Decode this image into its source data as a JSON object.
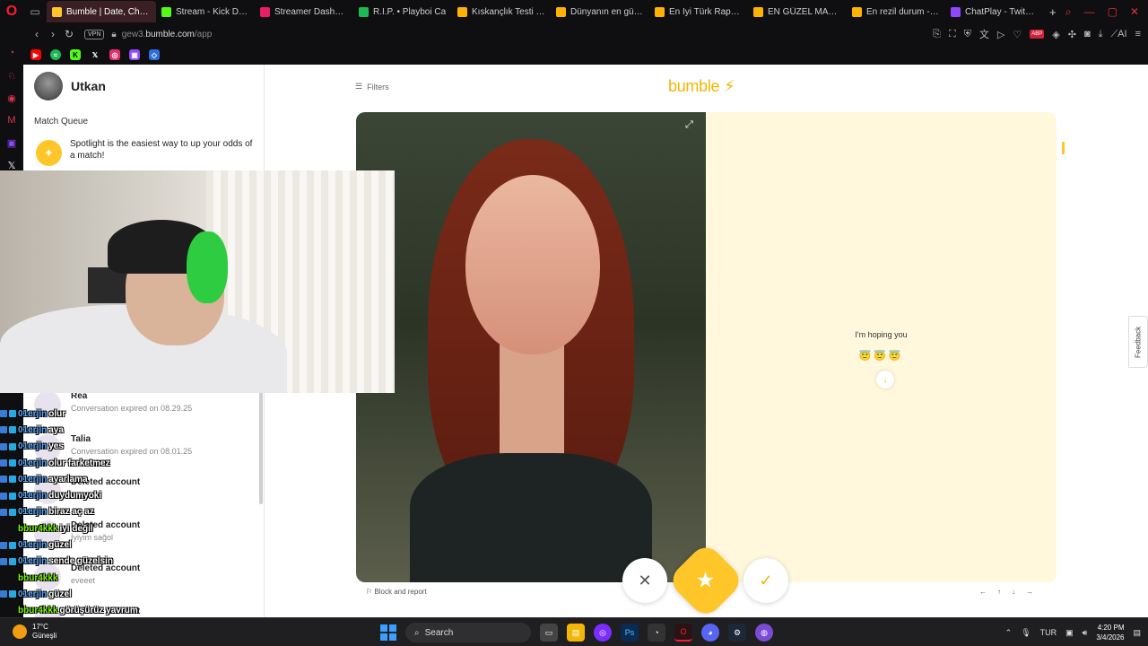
{
  "browser": {
    "tabs": [
      {
        "label": "Bumble | Date, Chat, Meet",
        "color": "#ffc629",
        "active": true
      },
      {
        "label": "Stream - Kick Dashb",
        "color": "#53fc18"
      },
      {
        "label": "Streamer Dashboard",
        "color": "#e91e63"
      },
      {
        "label": "R.I.P. • Playboi Ca",
        "color": "#1db954"
      },
      {
        "label": "Kıskançlık Testi - Tier",
        "color": "#ffb300"
      },
      {
        "label": "Dünyanın en güzel şe",
        "color": "#ffb300"
      },
      {
        "label": "En İyi Türk Rapçi - Ti",
        "color": "#ffb300"
      },
      {
        "label": "EN GÜZEL MANİFES",
        "color": "#ffb300"
      },
      {
        "label": "En rezil durum - Tier",
        "color": "#ffb300"
      },
      {
        "label": "ChatPlay - Twitch & K",
        "color": "#9146ff"
      }
    ],
    "vpn_label": "VPN",
    "url_prefix": "gew3.",
    "url_domain": "bumble.com",
    "url_path": "/app",
    "ai_label": "AI"
  },
  "left_panel": {
    "user_name": "Utkan",
    "match_queue_title": "Match Queue",
    "spotlight_text": "Spotlight is the easiest way to up your odds of a match!",
    "conversations": [
      {
        "name": "Rea",
        "message": "Conversation expired on 08.29.25"
      },
      {
        "name": "Talia",
        "message": "Conversation expired on 08.01.25"
      },
      {
        "name": "Deleted account",
        "message": ""
      },
      {
        "name": "Deleted account",
        "message": "İyiyim sağol"
      },
      {
        "name": "Deleted account",
        "message": "eveeet"
      },
      {
        "name": "Deleted account",
        "message": ""
      }
    ]
  },
  "main": {
    "filters_label": "Filters",
    "logo_text": "bumble",
    "hoping_text": "I'm hoping you",
    "emojis": "😇😇😇",
    "block_report_label": "Block and report",
    "keyboard_hints": [
      "←",
      "↑",
      "↓",
      "→"
    ],
    "feedback_label": "Feedback"
  },
  "chat": [
    {
      "user": "01erjin",
      "msg": "olur",
      "green": false
    },
    {
      "user": "01erjin",
      "msg": "aya",
      "green": false
    },
    {
      "user": "01erjin",
      "msg": "yes",
      "green": false
    },
    {
      "user": "01erjin",
      "msg": "olur farketmez",
      "green": false
    },
    {
      "user": "01erjin",
      "msg": "ayarlama",
      "green": false
    },
    {
      "user": "01erjin",
      "msg": "duydumyoki",
      "green": false
    },
    {
      "user": "01erjin",
      "msg": "biraz aç az",
      "green": false
    },
    {
      "user": "bbur4kkk",
      "msg": "iyi değil",
      "green": true
    },
    {
      "user": "01erjin",
      "msg": "güzel",
      "green": false
    },
    {
      "user": "01erjin",
      "msg": "sende güzelsin",
      "green": false
    },
    {
      "user": "bbur4kkk",
      "msg": "",
      "green": true
    },
    {
      "user": "01erjin",
      "msg": "güzel",
      "green": false
    },
    {
      "user": "bbur4kkk",
      "msg": "görüşürüz yavrum",
      "green": true
    }
  ],
  "taskbar": {
    "temperature": "17°C",
    "weather_desc": "Güneşli",
    "search_placeholder": "Search",
    "language": "TUR",
    "time": "4:20 PM",
    "date": "3/4/2026"
  }
}
